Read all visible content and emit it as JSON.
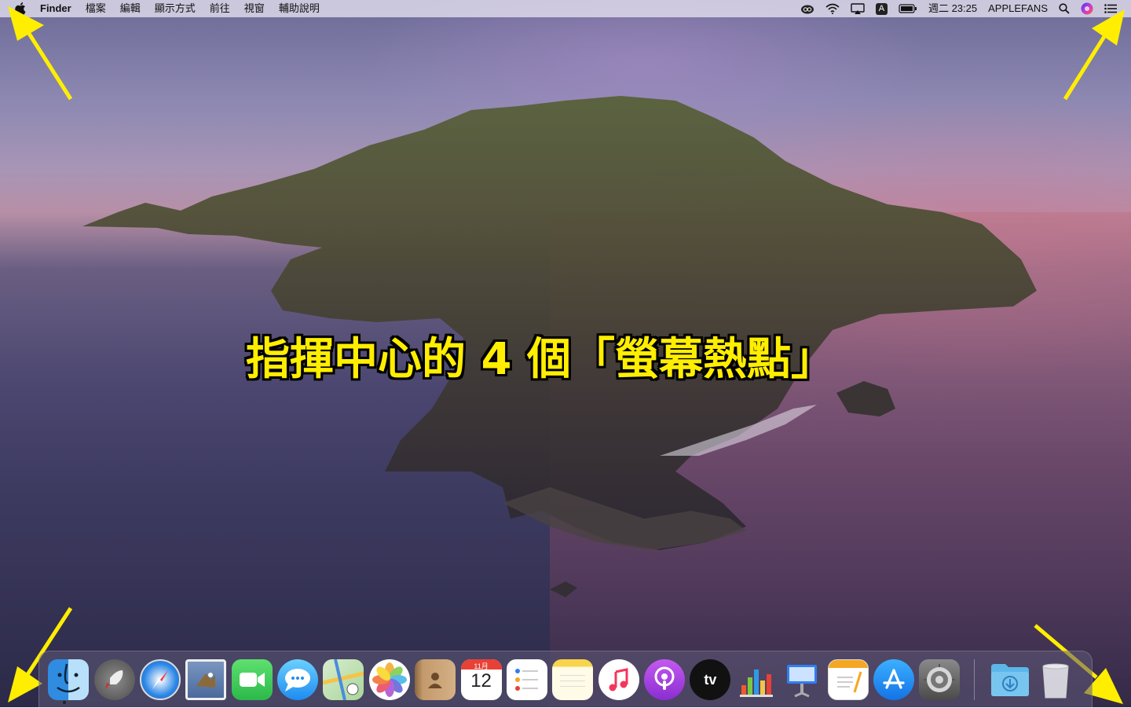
{
  "menubar": {
    "app_name": "Finder",
    "menus": [
      "檔案",
      "編輯",
      "顯示方式",
      "前往",
      "視窗",
      "輔助說明"
    ],
    "status": {
      "input_method": "A",
      "datetime": "週二 23:25",
      "user": "APPLEFANS"
    }
  },
  "headline": "指揮中心的 4 個「螢幕熱點」",
  "dock": {
    "calendar": {
      "month": "11月",
      "day": "12"
    },
    "tv_label": "tv",
    "apps": [
      "finder",
      "launchpad",
      "safari",
      "mail",
      "facetime",
      "messages",
      "maps",
      "photos",
      "contacts",
      "calendar",
      "reminders",
      "notes",
      "music",
      "podcasts",
      "tv",
      "numbers",
      "keynote",
      "pages",
      "app-store",
      "system-preferences"
    ],
    "right": [
      "downloads",
      "trash"
    ]
  },
  "colors": {
    "highlight": "#ffee00",
    "arrow": "#ffee00"
  }
}
